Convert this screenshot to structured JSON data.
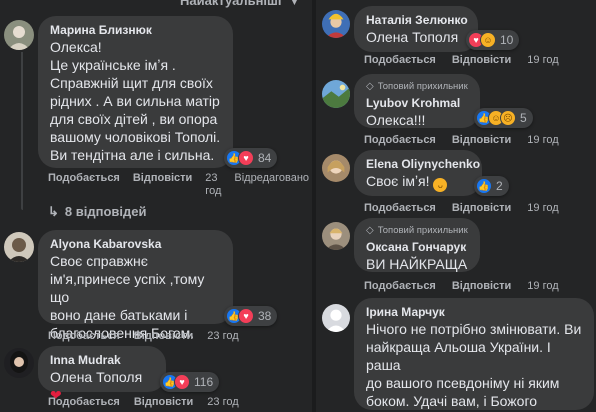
{
  "sort_label": "Найактуальніші",
  "left": {
    "comments": [
      {
        "author": "Марина Близнюк",
        "text": "Олекса!\nЦе українське імʼя .\nСправжній щит для своїх\nрідних . А ви сильна матір\nдля своїх дітей , ви опора\nвашому чоловікові Тополі.\nВи тендітна але і сильна.",
        "reaction_count": "84",
        "like_label": "Подобається",
        "reply_label": "Відповісти",
        "time": "23\nгод",
        "edited": "Відредаговано"
      },
      {
        "author": "Alyona Kabarovska",
        "text": "Своє справжнє\nім'я,принесе успіх ,тому що\nвоно дане батьками і\nблагословення Богом.",
        "reaction_count": "38",
        "like_label": "Подобається",
        "reply_label": "Відповісти",
        "time": "23 год"
      },
      {
        "author": "Inna Mudrak",
        "text": "Олена Тополя",
        "reaction_count": "116",
        "like_label": "Подобається",
        "reply_label": "Відповісти",
        "time": "23 год"
      }
    ],
    "replies_label": "8 відповідей"
  },
  "right": {
    "comments": [
      {
        "author": "Наталія Зелюнко",
        "text": "Олена Тополя",
        "reaction_count": "10",
        "like_label": "Подобається",
        "reply_label": "Відповісти",
        "time": "19 год"
      },
      {
        "badge": "Топовий прихильник",
        "author": "Lyubov Krohmal",
        "text": "Олекса!!!",
        "reaction_count": "5",
        "like_label": "Подобається",
        "reply_label": "Відповісти",
        "time": "19 год"
      },
      {
        "author": "Elena Oliynychenko",
        "text": "Своє імʼя!",
        "reaction_count": "2",
        "like_label": "Подобається",
        "reply_label": "Відповісти",
        "time": "19 год"
      },
      {
        "badge": "Топовий прихильник",
        "author": "Оксана Гончарук",
        "text": "ВИ НАЙКРАЩА",
        "like_label": "Подобається",
        "reply_label": "Відповісти",
        "time": "19 год"
      },
      {
        "author": "Ірина Марчук",
        "text": "Нічого не потрібно змінювати. Ви\nнайкраща Альоша України. І раша\nдо вашого псевдоніму ні яким\nбоком. Удачі вам, і Божого\nблагословення."
      }
    ]
  },
  "colors": {
    "background": "#242526",
    "bubble": "#3a3b3c",
    "like_blue": "#1877f2",
    "love_red": "#f33e58",
    "care_yellow": "#f7b125"
  }
}
